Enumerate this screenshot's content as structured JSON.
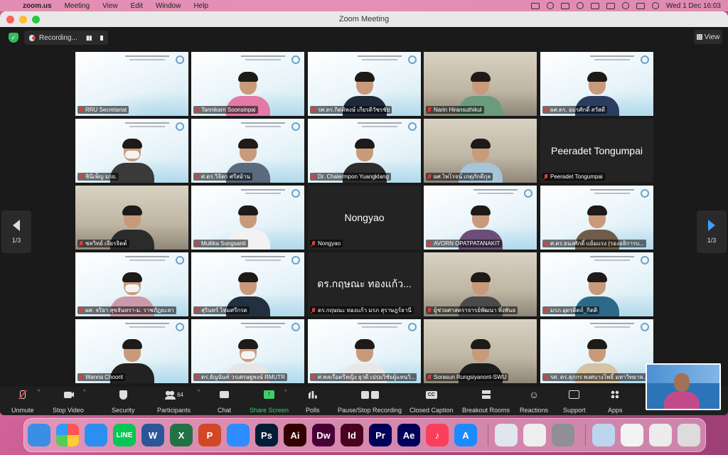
{
  "menubar": {
    "app_name": "zoom.us",
    "items": [
      "Meeting",
      "View",
      "Edit",
      "Window",
      "Help"
    ],
    "clock": "Wed 1 Dec  16:03"
  },
  "window": {
    "title": "Zoom Meeting",
    "recording_label": "Recording...",
    "view_label": "View"
  },
  "pager": {
    "left_label": "1/3",
    "right_label": "1/3"
  },
  "participants": [
    {
      "name": "RRU Secretariat",
      "kind": "slide"
    },
    {
      "name": "Tannikarn Soonsinpai",
      "kind": "slide-person"
    },
    {
      "name": "รศ.ดร.กิตติพงษ์ เกียรติวัชรชัย",
      "kind": "slide-person"
    },
    {
      "name": "Narin Hiransuthikul",
      "kind": "room-person"
    },
    {
      "name": "ผศ.ดร. อมรศักดิ์ สวัสดี",
      "kind": "slide-person"
    },
    {
      "name": "ชินีเพ็ญ มรย.",
      "kind": "mask-person"
    },
    {
      "name": "ศ.ดร.วิจิตร ศรีสอ้าน",
      "kind": "slide-person"
    },
    {
      "name": "Dr. Chalermpon Yuangklang",
      "kind": "slide-person"
    },
    {
      "name": "ผศ.ไพโรจน์ เกตุภักดีกุล",
      "kind": "room-person"
    },
    {
      "name": "Peeradet Tongumpai",
      "kind": "name-only",
      "display": "Peeradet Tongumpai"
    },
    {
      "name": "ชลวิทย์ เจียรจิตต์",
      "kind": "room-person"
    },
    {
      "name": "Mullika Sungsanit",
      "kind": "slide-person"
    },
    {
      "name": "Nongyao",
      "kind": "name-only",
      "display": "Nongyao"
    },
    {
      "name": "AVORN OPATPATANAKIT",
      "kind": "slide-person"
    },
    {
      "name": "ศ.ดร.ธนงศักดิ์ แย้มแรง (รองอธิการบ...",
      "kind": "slide-person"
    },
    {
      "name": "ผศ. จริยา สุขจันทรา-ม. ราชภัฏยะลา",
      "kind": "mask-person"
    },
    {
      "name": "สุรินทร์ ไหมศรีกรด",
      "kind": "slide-person"
    },
    {
      "name": "ดร.กฤษณะ ทองแก้ว มรภ สุราษฎร์ธานี",
      "kind": "name-only",
      "display": "ดร.กฤษณะ ทองแก้ว..."
    },
    {
      "name": "ผู้ช่วยศาสตราจารย์พัฒนา พึ่งพันธ",
      "kind": "room-person"
    },
    {
      "name": "มรภ.อุตรดิตถ์_กิตติ",
      "kind": "slide-person"
    },
    {
      "name": "Wanna Choorit",
      "kind": "slide-person"
    },
    {
      "name": "ดร.ธัญนันท์ วรเศรษฐพงษ์ RMUTR",
      "kind": "mask-person"
    },
    {
      "name": "ศ.พลเรือตรีหญิง ยุวดี เปรมวิชัยผู้แทนวิ...",
      "kind": "slide-person"
    },
    {
      "name": "Sorasun Rungsiyanont-SWU",
      "kind": "room-person"
    },
    {
      "name": "รศ. ดร.สุภกร พงศบางโพธิ์ มหาวิทยาล...",
      "kind": "slide-person"
    }
  ],
  "toolbar": {
    "unmute": "Unmute",
    "stop_video": "Stop Video",
    "security": "Security",
    "participants": "Participants",
    "participants_count": "64",
    "chat": "Chat",
    "share_screen": "Share Screen",
    "polls": "Polls",
    "pause_stop_recording": "Pause/Stop Recording",
    "closed_caption": "Closed Caption",
    "breakout_rooms": "Breakout Rooms",
    "reactions": "Reactions",
    "support": "Support",
    "apps": "Apps"
  },
  "dock": {
    "apps": [
      {
        "name": "finder-icon",
        "color": "#3a8ee6",
        "glyph": ""
      },
      {
        "name": "launchpad-icon",
        "color": "#e8e8ec",
        "glyph": ""
      },
      {
        "name": "safari-icon",
        "color": "#2a8ff0",
        "glyph": ""
      },
      {
        "name": "line-icon",
        "color": "#06c755",
        "glyph": "LINE"
      },
      {
        "name": "word-icon",
        "color": "#2b579a",
        "glyph": "W"
      },
      {
        "name": "excel-icon",
        "color": "#217346",
        "glyph": "X"
      },
      {
        "name": "powerpoint-icon",
        "color": "#d24726",
        "glyph": "P"
      },
      {
        "name": "zoom-icon",
        "color": "#2d8cff",
        "glyph": ""
      },
      {
        "name": "photoshop-icon",
        "color": "#001e36",
        "glyph": "Ps"
      },
      {
        "name": "illustrator-icon",
        "color": "#330000",
        "glyph": "Ai"
      },
      {
        "name": "dreamweaver-icon",
        "color": "#470137",
        "glyph": "Dw"
      },
      {
        "name": "indesign-icon",
        "color": "#49021f",
        "glyph": "Id"
      },
      {
        "name": "premiere-icon",
        "color": "#00005b",
        "glyph": "Pr"
      },
      {
        "name": "after-effects-icon",
        "color": "#00005b",
        "glyph": "Ae"
      },
      {
        "name": "music-icon",
        "color": "#fa3f5c",
        "glyph": "♪"
      },
      {
        "name": "app-store-icon",
        "color": "#1a8cff",
        "glyph": "A"
      },
      {
        "name": "quicktime-icon",
        "color": "#dfe6ee",
        "glyph": ""
      },
      {
        "name": "acrobat-icon",
        "color": "#eeeeee",
        "glyph": ""
      },
      {
        "name": "system-preferences-icon",
        "color": "#8f8f94",
        "glyph": ""
      },
      {
        "name": "recent-doc-1-icon",
        "color": "#bcd6ef",
        "glyph": ""
      },
      {
        "name": "recent-doc-2-icon",
        "color": "#f3f3f3",
        "glyph": ""
      },
      {
        "name": "recent-doc-3-icon",
        "color": "#ececec",
        "glyph": ""
      },
      {
        "name": "trash-icon",
        "color": "#dcdcdc",
        "glyph": ""
      }
    ]
  },
  "colors": {
    "share_green": "#3dd068",
    "mic_off_red": "#e23b3b",
    "pager_blue": "#3fa0ff"
  }
}
